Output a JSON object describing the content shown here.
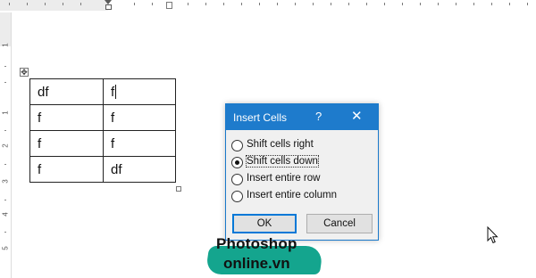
{
  "table": {
    "rows": [
      [
        "df",
        "f"
      ],
      [
        "f",
        "f"
      ],
      [
        "f",
        "f"
      ],
      [
        "f",
        "df"
      ]
    ]
  },
  "ruler": {
    "vertical_numbers": [
      "1",
      "1",
      "2",
      "3",
      "4",
      "5"
    ]
  },
  "dialog": {
    "title": "Insert Cells",
    "help_glyph": "?",
    "close_glyph": "✕",
    "options": [
      {
        "label": "Shift cells right",
        "selected": false
      },
      {
        "label": "Shift cells down",
        "selected": true
      },
      {
        "label": "Insert entire row",
        "selected": false
      },
      {
        "label": "Insert entire column",
        "selected": false
      }
    ],
    "ok_label": "OK",
    "cancel_label": "Cancel"
  },
  "watermark": {
    "line1": "Photoshop",
    "line2": "online.vn"
  },
  "colors": {
    "titlebar": "#1e7bcc",
    "watermark_band": "#14a58e"
  },
  "icons": {
    "table_move": "move-arrows-icon",
    "cursor": "mouse-pointer-icon"
  }
}
